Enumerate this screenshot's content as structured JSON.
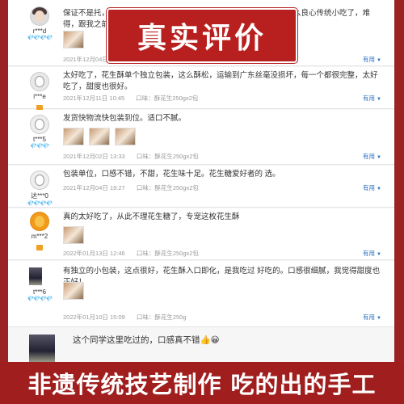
{
  "stamp": "真实评价",
  "banner": "非遗传统技艺制作 吃的出的手工",
  "useful_label": "有用",
  "reviews": [
    {
      "user": "r***d",
      "vip": "💎💎💎💎",
      "text": "保证不是托，太好吃了，麦芽糖做的花生酥，很地道，现在很少有这么良心传统小吃了，难得，跟我之前在新加坡买的",
      "date": "2021年12月04日",
      "flavor": ""
    },
    {
      "user": "i***e",
      "vip": "",
      "text": "太好吃了，花生酥单个独立包装，这么酥松，运输到广东丝毫没损坏，每一个都很完整，太好吃了，甜度也很好。",
      "date": "2021年12月11日 10:45",
      "flavor": "口味：酥花生250gx2包"
    },
    {
      "user": "t***5",
      "vip": "💎💎💎",
      "text": "发货快物流快包装到位。适口不腻。",
      "date": "2021年12月02日 13:33",
      "flavor": "口味：酥花生250gx2包"
    },
    {
      "user": "达***0",
      "vip": "💎💎💎💎",
      "text": "包装单位，口感不错，不甜，花生味十足。花生糖爱好者的 选。",
      "date": "2021年12月04日 19:27",
      "flavor": "口味：酥花生250gx2包"
    },
    {
      "user": "m***2",
      "vip": "",
      "text": "真的太好吃了，从此不理花生糖了，专宠这枚花生酥",
      "date": "2022年01月13日 12:46",
      "flavor": "口味：酥花生250gx2包"
    },
    {
      "user": "t***6",
      "vip": "💎💎💎💎",
      "text": "有独立的小包装，这点很好，花生酥入口即化，是我吃过 好吃的。口感很细腻，我觉得甜度也正好！",
      "date": "2022年01月10日 15:09",
      "flavor": "口味：酥花生250g"
    },
    {
      "user": "",
      "vip": "",
      "text": "这个同学这里吃过的，口感真不错👍😀",
      "date": "",
      "flavor": ""
    }
  ]
}
